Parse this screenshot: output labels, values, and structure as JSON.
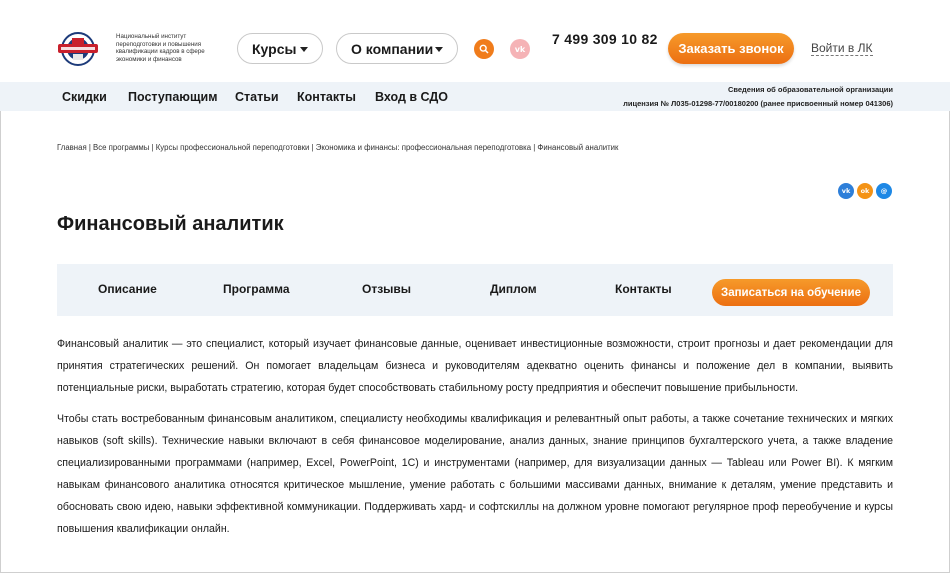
{
  "header": {
    "logo_text": "Национальный институт переподготовки и повышения квалификации кадров в сфере экономики и финансов",
    "menu": [
      {
        "label": "Курсы"
      },
      {
        "label": "О компании"
      }
    ],
    "phone": "7 499 309 10 82",
    "callback_label": "Заказать звонок",
    "login_label": "Войти в ЛК",
    "icons": {
      "search": "search-icon",
      "vk": "vk-icon",
      "logo": "logo-emblem"
    },
    "accent_color": "#f07c1b"
  },
  "nav": {
    "items": [
      "Скидки",
      "Поступающим",
      "Статьи",
      "Контакты",
      "Вход в СДО"
    ],
    "license_line1": "Сведения об образовательной организации",
    "license_line2": "лицензия № Л035-01298-77/00180200 (ранее присвоенный номер 041306)"
  },
  "breadcrumbs": [
    "Главная",
    "Все программы",
    "Курсы профессиональной переподготовки",
    "Экономика и финансы: профессиональная переподготовка",
    "Финансовый аналитик"
  ],
  "share": {
    "vk": "vk",
    "ok": "ok",
    "mm": "@"
  },
  "page_title": "Финансовый аналитик",
  "tabs": {
    "items": [
      "Описание",
      "Программа",
      "Отзывы",
      "Диплом",
      "Контакты"
    ],
    "enroll_label": "Записаться на обучение"
  },
  "content": {
    "paragraphs": [
      "Финансовый аналитик — это специалист, который изучает финансовые данные, оценивает инвестиционные возможности, строит прогнозы и дает рекомендации для принятия стратегических решений. Он помогает владельцам бизнеса и руководителям адекватно оценить финансы и положение дел в компании, выявить потенциальные риски, выработать стратегию, которая будет способствовать стабильному росту предприятия и обеспечит повышение прибыльности.",
      "Чтобы стать востребованным финансовым аналитиком, специалисту необходимы квалификация и релевантный опыт работы, а также сочетание технических и мягких навыков (soft skills). Технические навыки включают в себя финансовое моделирование, анализ данных, знание принципов бухгалтерского учета, а также владение специализированными программами (например, Excel, PowerPoint, 1С) и инструментами (например, для визуализации данных — Tableau или Power BI). К мягким навыкам финансового аналитика относятся критическое мышление, умение работать с большими массивами данных, внимание к деталям, умение представить и обосновать свою идею, навыки эффективной коммуникации. Поддерживать хард- и софтскиллы на должном уровне помогают регулярное проф переобучение и курсы повышения квалификации онлайн."
    ]
  }
}
